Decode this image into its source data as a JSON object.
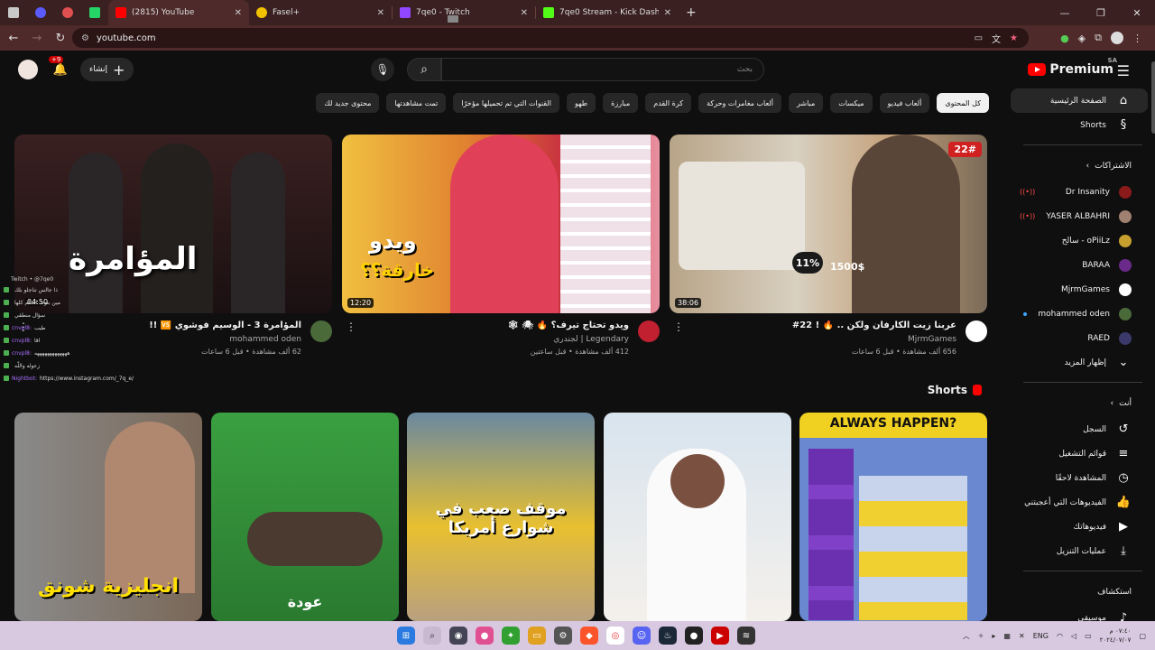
{
  "browser": {
    "tabs": [
      {
        "title": "(2815) YouTube",
        "color": "#ff0000"
      },
      {
        "title": "Fasel+",
        "color": "#f2c200"
      },
      {
        "title": "7qe0 - Twitch",
        "color": "#9146ff"
      },
      {
        "title": "7qe0 Stream - Kick Dashboard",
        "color": "#53fc18"
      }
    ],
    "new_tab": "+",
    "url": "youtube.com"
  },
  "header": {
    "logo_text": "Premium",
    "region": "SA",
    "search_placeholder": "بحث",
    "create_label": "إنشاء",
    "notif_count": "+9"
  },
  "chips": [
    "كل المحتوى",
    "ألعاب فيديو",
    "ميكسات",
    "مباشر",
    "ألعاب مغامرات وحركة",
    "كرة القدم",
    "مبارزة",
    "طهو",
    "القنوات التي تم تحميلها مؤخرًا",
    "تمت مشاهدتها",
    "محتوى جديد لك"
  ],
  "sidebar": {
    "main": [
      {
        "label": "الصفحة الرئيسية",
        "icon": "home-icon",
        "glyph": "⌂"
      },
      {
        "label": "Shorts",
        "icon": "shorts-icon",
        "glyph": "§"
      }
    ],
    "subs_header": "الاشتراكات",
    "subs": [
      {
        "label": "Dr Insanity",
        "color": "#8b1a1a",
        "live": true
      },
      {
        "label": "YASER ALBAHRI",
        "color": "#a08070",
        "live": true
      },
      {
        "label": "oPiiLz - سالح",
        "color": "#c8a030",
        "live": false
      },
      {
        "label": "BARAA",
        "color": "#6a2a8a",
        "live": false
      },
      {
        "label": "MjrmGames",
        "color": "#ffffff",
        "live": false
      },
      {
        "label": "mohammed oden",
        "color": "#4a6a3a",
        "live": false,
        "dot": true
      },
      {
        "label": "RAED",
        "color": "#3a3a6a",
        "live": false
      }
    ],
    "show_more": "إظهار المزيد",
    "you_header": "أنت",
    "you": [
      {
        "label": "السجل",
        "icon": "history-icon",
        "glyph": "↺"
      },
      {
        "label": "قوائم التشغيل",
        "icon": "playlists-icon",
        "glyph": "≡"
      },
      {
        "label": "المشاهدة لاحقًا",
        "icon": "watch-later-icon",
        "glyph": "◷"
      },
      {
        "label": "الفيديوهات التي أعجبتني",
        "icon": "like-icon",
        "glyph": "👍"
      },
      {
        "label": "فيديوهاتك",
        "icon": "your-videos-icon",
        "glyph": "▶"
      },
      {
        "label": "عمليات التنزيل",
        "icon": "download-icon",
        "glyph": "⤓"
      }
    ],
    "explore_header": "استكشاف",
    "explore": [
      {
        "label": "موسيقى",
        "icon": "music-icon",
        "glyph": "♪"
      }
    ]
  },
  "videos": [
    {
      "title": "عربنا زيت الكارفان ولكن .. 🔥 ! 22#",
      "channel": "MjrmGames",
      "stats": "656 ألف مشاهدة • قبل 6 ساعات",
      "duration": "38:06",
      "thumb_caption": "11%",
      "thumb_caption2": "1500$",
      "avatar_color": "#ffffff"
    },
    {
      "title": "ويدو تحتاج تيرف؟ 🔥 🕷 🕸",
      "channel": "Legendary | لجندري",
      "stats": "412 ألف مشاهدة • قبل ساعتين",
      "duration": "12:20",
      "thumb_caption": "ويدو",
      "thumb_caption2": "خارقة؟؟",
      "avatar_color": "#c02030"
    },
    {
      "title": "المؤامرة 3 - الوسيم فوشوي 🆚 !!",
      "channel": "mohammed oden",
      "stats": "62 ألف مشاهدة • قبل 6 ساعات",
      "duration": "",
      "thumb_caption": "المؤامرة",
      "thumb_caption2": "",
      "avatar_color": "#4a6a3a"
    }
  ],
  "shorts_label": "Shorts",
  "shorts": [
    {
      "caption": "ALWAYS HAPPEN?",
      "bg": "#5a78c8"
    },
    {
      "caption": "",
      "bg": "#c8d8e8"
    },
    {
      "caption": "موقف صعب في شوارع أمريكا",
      "bg": "#3a6ab0"
    },
    {
      "caption": "عودة",
      "bg": "#2a8a3a"
    },
    {
      "caption": "انجليزية شونق",
      "bg": "#6a5a4a"
    }
  ],
  "stream_overlay": {
    "header": "Twitch • @7qe0",
    "timer": "04:50",
    "chat": [
      {
        "user": "",
        "msg": "ذا جالس تناجلو بلك"
      },
      {
        "user": "",
        "msg": "مين بتوت العالم كلها"
      },
      {
        "user": "",
        "msg": "سؤال منطقي"
      },
      {
        "user": "cnvpl8:",
        "msg": "طيب"
      },
      {
        "user": "cnvpl8:",
        "msg": "اقا"
      },
      {
        "user": "cnvpl8:",
        "msg": "هههههههههههههه"
      },
      {
        "user": "",
        "msg": "زعوله واللّه"
      },
      {
        "user": "Nightbot:",
        "msg": "https://www.instagram.com/_7q_e/"
      }
    ]
  },
  "taskbar": {
    "lang": "ENG",
    "time": "٠٧:٤٠ م",
    "date": "٢٠٢٤/٠٧/٠٧"
  }
}
